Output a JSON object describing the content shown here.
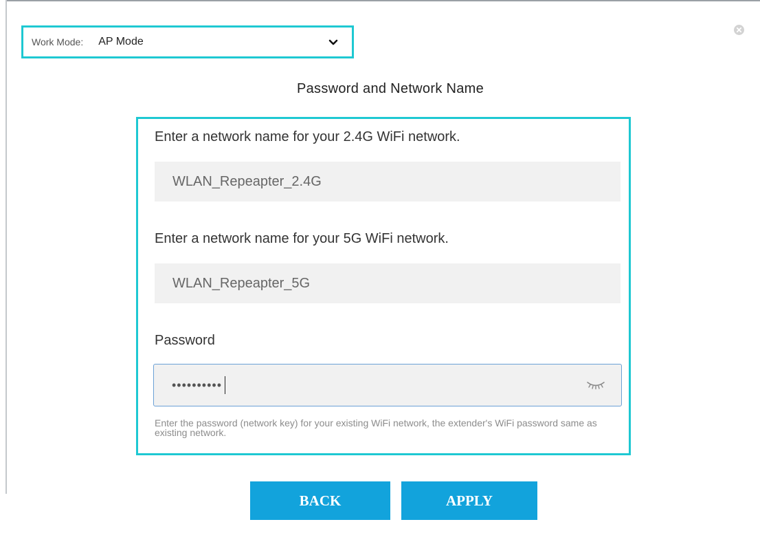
{
  "work_mode": {
    "label": "Work Mode:",
    "selected": "AP Mode"
  },
  "dialog": {
    "title": "Password and Network Name"
  },
  "wifi_24g": {
    "label": "Enter a network name for your 2.4G WiFi network.",
    "value": "WLAN_Repeapter_2.4G"
  },
  "wifi_5g": {
    "label": "Enter a network name for your 5G WiFi network.",
    "value": "WLAN_Repeapter_5G"
  },
  "password": {
    "label": "Password",
    "masked_value": "••••••••••",
    "hint": "Enter the password (network key) for your existing WiFi network, the extender's WiFi password same as existing network.",
    "toggle_icon": "eye-closed-icon"
  },
  "buttons": {
    "back": "BACK",
    "apply": "APPLY"
  },
  "colors": {
    "highlight": "#1ec8d2",
    "button": "#12a3dc",
    "field_bg": "#f1f1f1"
  }
}
